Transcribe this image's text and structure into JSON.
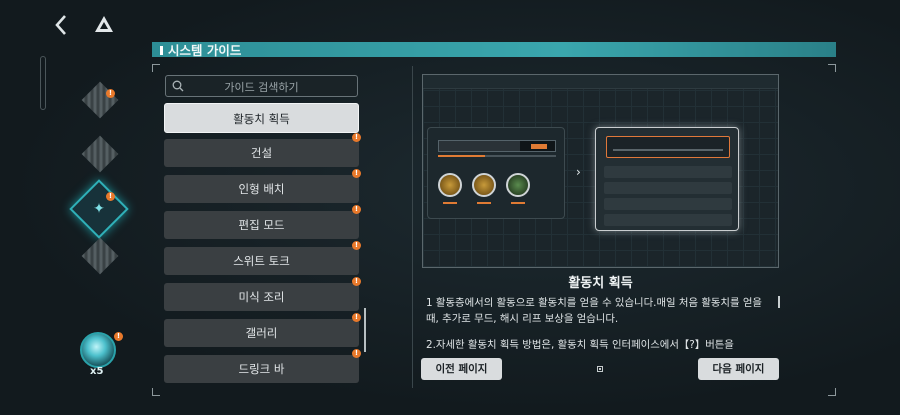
{
  "header": {
    "title": "시스템 가이드"
  },
  "search": {
    "placeholder": "가이드 검색하기"
  },
  "rail": {
    "token_count": "x5",
    "badge": "!"
  },
  "guide_list": [
    {
      "label": "활동치 획득",
      "selected": true,
      "badge": false
    },
    {
      "label": "건설",
      "selected": false,
      "badge": true
    },
    {
      "label": "인형 배치",
      "selected": false,
      "badge": true
    },
    {
      "label": "편집 모드",
      "selected": false,
      "badge": true
    },
    {
      "label": "스위트 토크",
      "selected": false,
      "badge": true
    },
    {
      "label": "미식 조리",
      "selected": false,
      "badge": true
    },
    {
      "label": "갤러리",
      "selected": false,
      "badge": true
    },
    {
      "label": "드링크 바",
      "selected": false,
      "badge": true
    }
  ],
  "detail": {
    "title": "활동치 획득",
    "paragraph1": "1 활동층에서의 활동으로 활동치를 얻을 수 있습니다.매일 처음 활동치를 얻을 때, 추가로 무드, 해시 리프 보상을 얻습니다.",
    "paragraph2": "2.자세한 활동치 획득 방법은, 활동치 획득 인터페이스에서【?】버튼을"
  },
  "buttons": {
    "prev": "이전 페이지",
    "next": "다음 페이지"
  },
  "colors": {
    "accent": "#2fb0b8",
    "badge": "#e8792b",
    "highlight": "#e0783a"
  }
}
